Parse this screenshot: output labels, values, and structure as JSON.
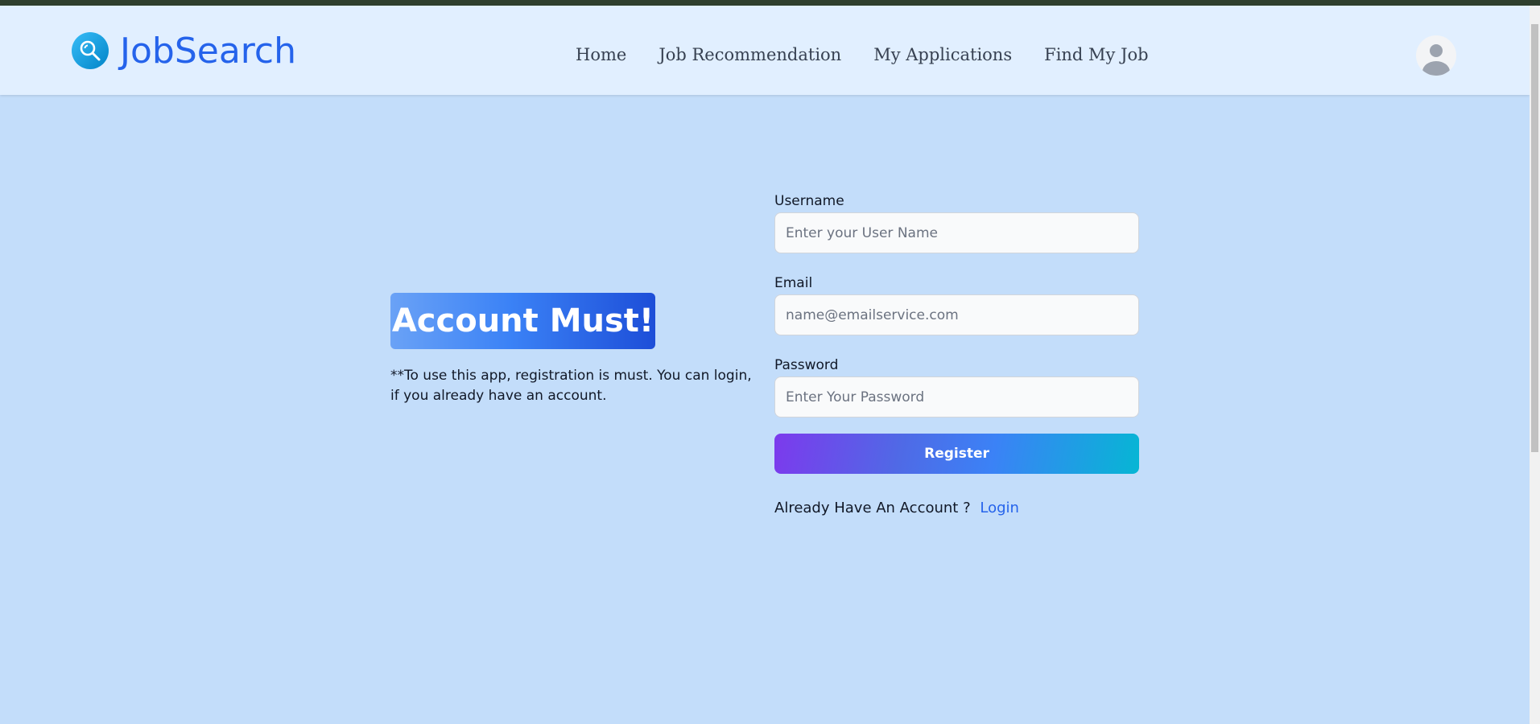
{
  "app": {
    "brand_name": "JobSearch",
    "brand_icon": "search-icon",
    "avatar_icon": "user-avatar-icon"
  },
  "nav": {
    "items": [
      {
        "label": "Home"
      },
      {
        "label": "Job Recommendation"
      },
      {
        "label": "My Applications"
      },
      {
        "label": "Find My Job"
      }
    ]
  },
  "hero": {
    "headline": "Account Must!",
    "note": "**To use this app, registration is must. You can login, if you already have an account."
  },
  "form": {
    "username": {
      "label": "Username",
      "placeholder": "Enter your User Name",
      "value": ""
    },
    "email": {
      "label": "Email",
      "placeholder": "name@emailservice.com",
      "value": ""
    },
    "password": {
      "label": "Password",
      "placeholder": "Enter Your Password",
      "value": ""
    },
    "submit_label": "Register",
    "login_prompt": "Already Have An Account ?",
    "login_link": "Login"
  },
  "colors": {
    "page_background": "#c3ddfa",
    "navbar_background": "#e1efff",
    "brand": "#2563eb",
    "link": "#2563eb",
    "button_gradient_start": "#7c3aed",
    "button_gradient_end": "#06b6d4"
  }
}
